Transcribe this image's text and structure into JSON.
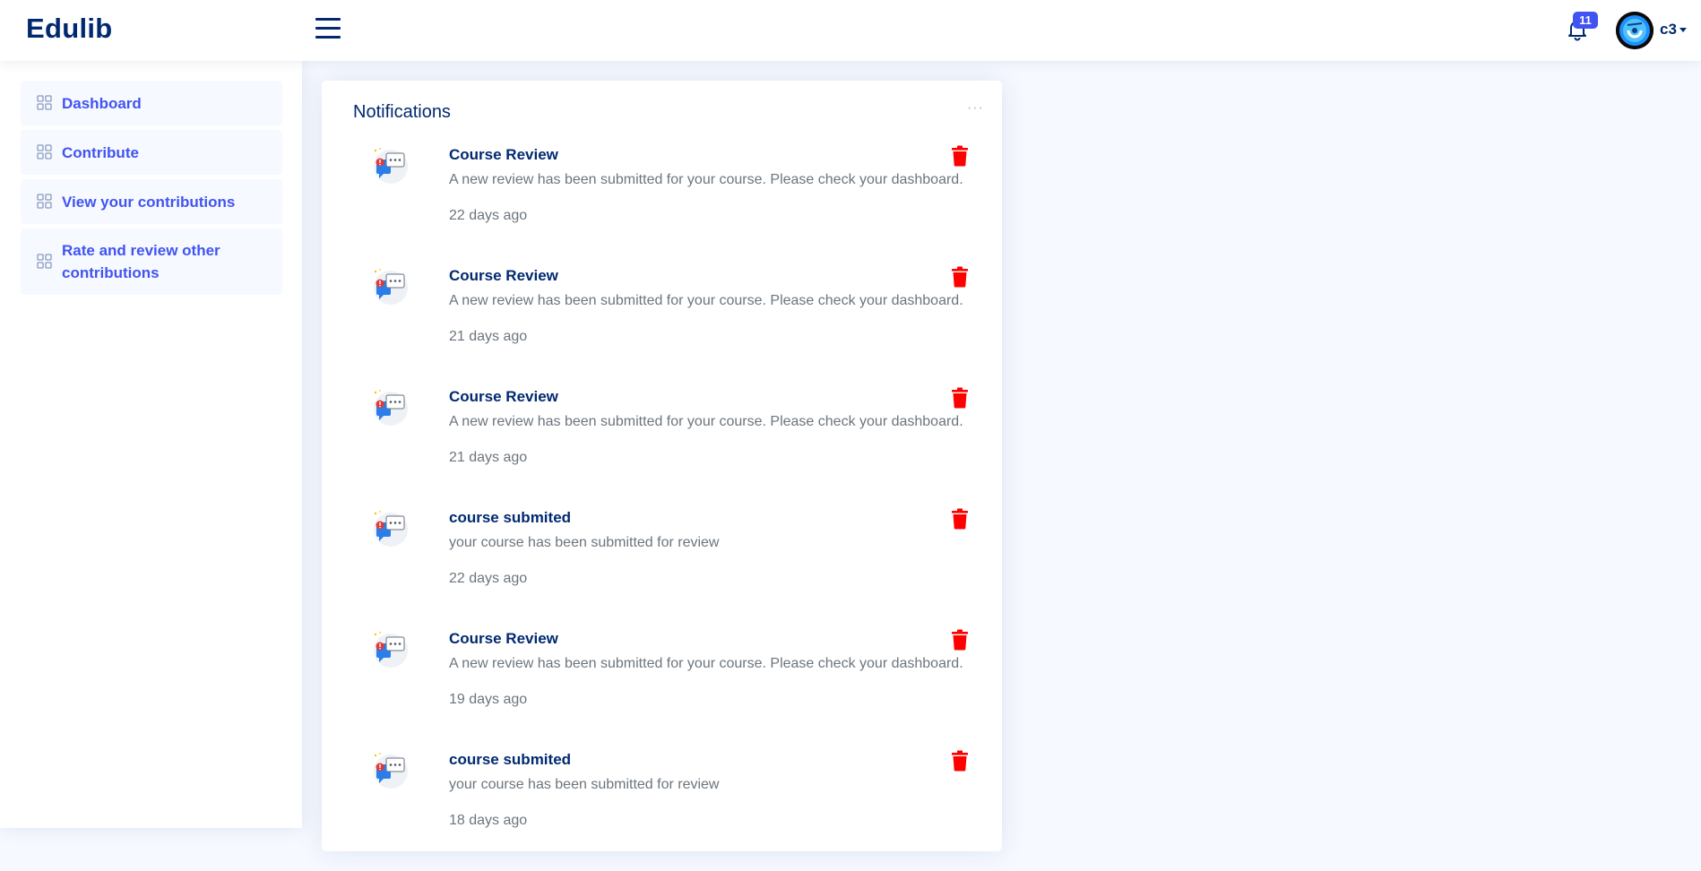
{
  "header": {
    "logo": "Edulib",
    "notification_count": "11",
    "user_name": "c3"
  },
  "sidebar": {
    "items": [
      {
        "label": "Dashboard"
      },
      {
        "label": "Contribute"
      },
      {
        "label": "View your contributions"
      },
      {
        "label": "Rate and review other contributions"
      }
    ]
  },
  "notifications": {
    "title": "Notifications",
    "more": "···",
    "items": [
      {
        "title": "Course Review",
        "message": "A new review has been submitted for your course. Please check your dashboard.",
        "time": "22 days ago"
      },
      {
        "title": "Course Review",
        "message": "A new review has been submitted for your course. Please check your dashboard.",
        "time": "21 days ago"
      },
      {
        "title": "Course Review",
        "message": "A new review has been submitted for your course. Please check your dashboard.",
        "time": "21 days ago"
      },
      {
        "title": "course submited",
        "message": "your course has been submitted for review",
        "time": "22 days ago"
      },
      {
        "title": "Course Review",
        "message": "A new review has been submitted for your course. Please check your dashboard.",
        "time": "19 days ago"
      },
      {
        "title": "course submited",
        "message": "your course has been submitted for review",
        "time": "18 days ago"
      }
    ]
  },
  "colors": {
    "brand": "#012970",
    "accent": "#4154f1",
    "delete": "#ff0000",
    "background": "#f6f9ff"
  },
  "icons": {
    "menu": "hamburger-icon",
    "bell": "bell-icon",
    "nav": "grid-icon",
    "notification": "chat-alert-icon",
    "delete": "trash-icon"
  }
}
